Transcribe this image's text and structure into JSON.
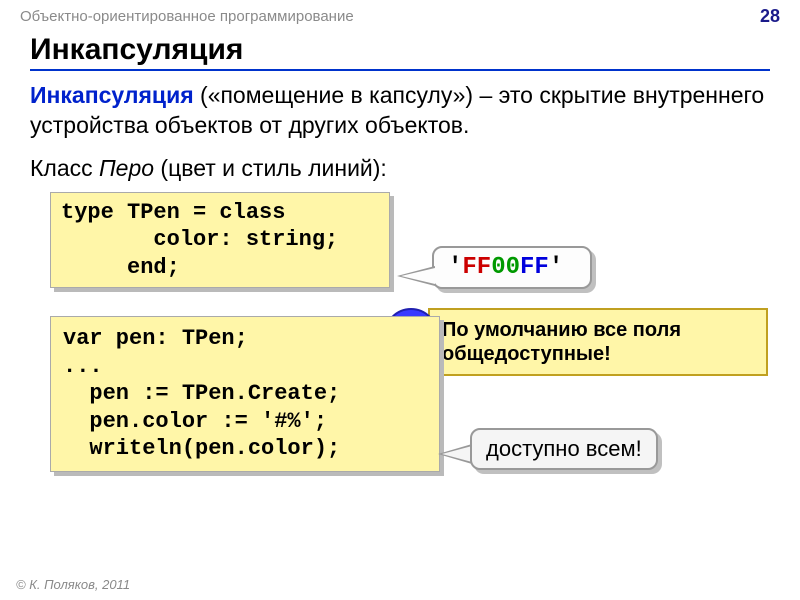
{
  "header": {
    "topic": "Объектно-ориентированное программирование",
    "page": "28"
  },
  "title": "Инкапсуляция",
  "definition": {
    "term": "Инкапсуляция",
    "rest": " («помещение в капсулу») – это скрытие внутреннего устройства объектов от других объектов."
  },
  "class_line": {
    "prefix": "Класс ",
    "name": "Перо",
    "suffix": " (цвет и стиль линий):"
  },
  "code1": "type TPen = class\n       color: string;\n     end;",
  "code2": "var pen: TPen;\n...\n  pen := TPen.Create;\n  pen.color := '#%';\n  writeln(pen.color);",
  "hex": {
    "quote": "'",
    "r": "FF",
    "g": "00",
    "b": "FF"
  },
  "note": {
    "icon": "!",
    "text": "По умолчанию все поля общедоступные!"
  },
  "avail": "доступно всем!",
  "footer": "© К. Поляков, 2011"
}
